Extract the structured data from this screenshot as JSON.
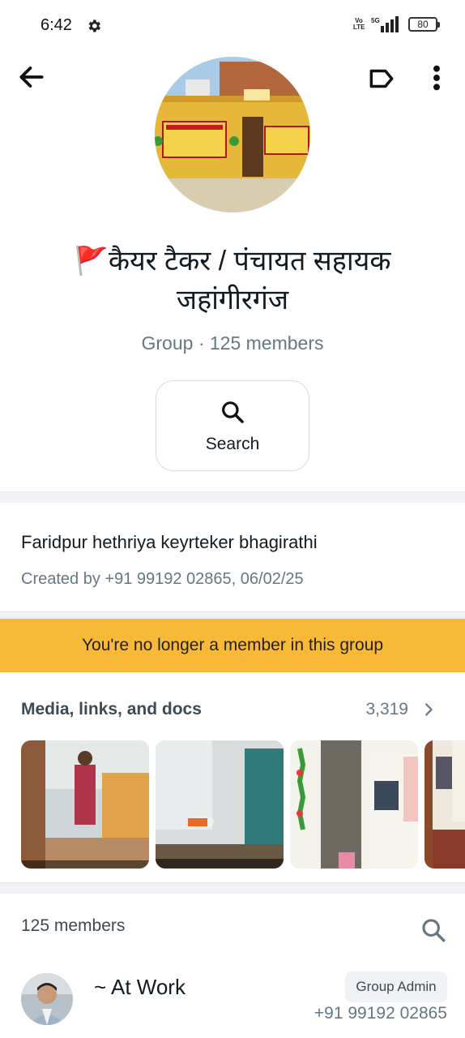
{
  "status_bar": {
    "time": "6:42",
    "network_tag": "Vo LTE",
    "network_type": "5G",
    "battery": "80",
    "icons": [
      "gear-icon",
      "signal-icon",
      "battery-icon"
    ]
  },
  "toolbar": {
    "icons": [
      "arrow-back-icon",
      "label-icon",
      "more-vertical-icon"
    ]
  },
  "group": {
    "name": "🚩कैयर टैकर / पंचायत सहायक जहांगीरगंज",
    "meta": "Group · 125 members",
    "search_label": "Search",
    "description": "Faridpur hethriya keyrteker bhagirathi",
    "created": "Created by +91 99192 02865, 06/02/25",
    "notice": "You're no longer a member in this group"
  },
  "media": {
    "title": "Media, links, and docs",
    "count": "3,319"
  },
  "members": {
    "title": "125 members",
    "list": [
      {
        "name": "~ At Work",
        "badge": "Group Admin",
        "phone": "+91 99192 02865"
      }
    ]
  },
  "colors": {
    "notice_bg": "#f8b838",
    "secondary_text": "#667781",
    "divider": "#f0f2f5"
  }
}
